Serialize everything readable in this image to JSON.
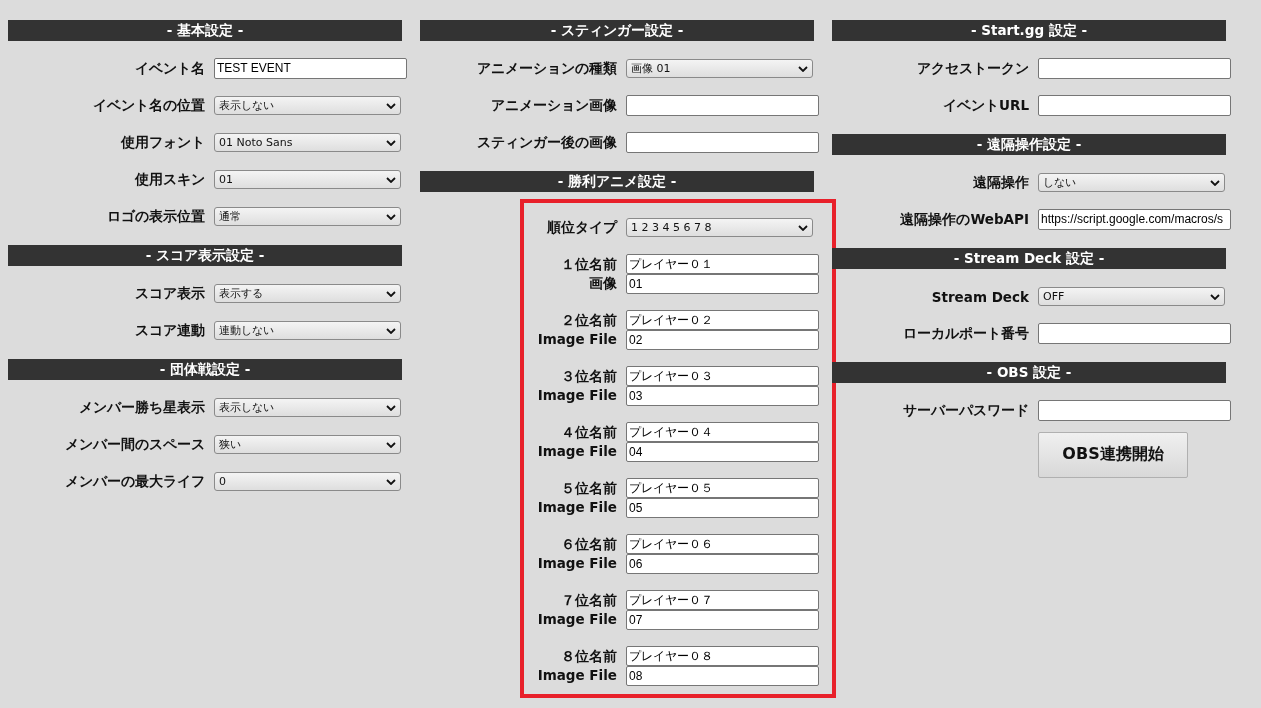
{
  "columns": [
    {
      "sections": [
        {
          "title": "- 基本設定 -",
          "highlighted": false,
          "fields": [
            {
              "kind": "text",
              "label": "イベント名",
              "value": "TEST EVENT"
            },
            {
              "kind": "select",
              "label": "イベント名の位置",
              "value": "表示しない"
            },
            {
              "kind": "select",
              "label": "使用フォント",
              "value": "01 Noto Sans"
            },
            {
              "kind": "select",
              "label": "使用スキン",
              "value": "01"
            },
            {
              "kind": "select",
              "label": "ロゴの表示位置",
              "value": "通常"
            }
          ]
        },
        {
          "title": "- スコア表示設定 -",
          "highlighted": false,
          "fields": [
            {
              "kind": "select",
              "label": "スコア表示",
              "value": "表示する"
            },
            {
              "kind": "select",
              "label": "スコア連動",
              "value": "連動しない"
            }
          ]
        },
        {
          "title": "- 団体戦設定 -",
          "highlighted": false,
          "fields": [
            {
              "kind": "select",
              "label": "メンバー勝ち星表示",
              "value": "表示しない"
            },
            {
              "kind": "select",
              "label": "メンバー間のスペース",
              "value": "狭い"
            },
            {
              "kind": "select",
              "label": "メンバーの最大ライフ",
              "value": "0"
            }
          ]
        }
      ]
    },
    {
      "sections": [
        {
          "title": "- スティンガー設定 -",
          "highlighted": false,
          "fields": [
            {
              "kind": "select",
              "label": "アニメーションの種類",
              "value": "画像 01"
            },
            {
              "kind": "text",
              "label": "アニメーション画像"
            },
            {
              "kind": "text",
              "label": "スティンガー後の画像"
            }
          ]
        },
        {
          "title": "- 勝利アニメ設定 -",
          "highlighted": true,
          "fields": [
            {
              "kind": "select",
              "label": "順位タイプ",
              "value": "1 2 3 4 5 6 7 8"
            },
            {
              "kind": "rank",
              "label": "１位名前",
              "value": "プレイヤー０１",
              "label2": "画像",
              "value2": "01"
            },
            {
              "kind": "rank",
              "label": "２位名前",
              "value": "プレイヤー０２",
              "label2": "Image File",
              "value2": "02"
            },
            {
              "kind": "rank",
              "label": "３位名前",
              "value": "プレイヤー０３",
              "label2": "Image File",
              "value2": "03"
            },
            {
              "kind": "rank",
              "label": "４位名前",
              "value": "プレイヤー０４",
              "label2": "Image File",
              "value2": "04"
            },
            {
              "kind": "rank",
              "label": "５位名前",
              "value": "プレイヤー０５",
              "label2": "Image File",
              "value2": "05"
            },
            {
              "kind": "rank",
              "label": "６位名前",
              "value": "プレイヤー０６",
              "label2": "Image File",
              "value2": "06"
            },
            {
              "kind": "rank",
              "label": "７位名前",
              "value": "プレイヤー０７",
              "label2": "Image File",
              "value2": "07"
            },
            {
              "kind": "rank",
              "label": "８位名前",
              "value": "プレイヤー０８",
              "label2": "Image File",
              "value2": "08"
            }
          ]
        }
      ]
    },
    {
      "sections": [
        {
          "title": "- Start.gg 設定 -",
          "highlighted": false,
          "fields": [
            {
              "kind": "text",
              "label": "アクセストークン"
            },
            {
              "kind": "text",
              "label": "イベントURL"
            }
          ]
        },
        {
          "title": "- 遠隔操作設定 -",
          "highlighted": false,
          "fields": [
            {
              "kind": "select",
              "label": "遠隔操作",
              "value": "しない"
            },
            {
              "kind": "text",
              "label": "遠隔操作のWebAPI",
              "value": "https://script.google.com/macros/s"
            }
          ]
        },
        {
          "title": "- Stream Deck 設定 -",
          "highlighted": false,
          "fields": [
            {
              "kind": "select",
              "label": "Stream Deck",
              "value": "OFF"
            },
            {
              "kind": "text",
              "label": "ローカルポート番号"
            }
          ]
        },
        {
          "title": "- OBS 設定 -",
          "highlighted": false,
          "fields": [
            {
              "kind": "text",
              "label": "サーバーパスワード"
            },
            {
              "kind": "button",
              "label": "OBS連携開始"
            }
          ]
        }
      ]
    }
  ]
}
